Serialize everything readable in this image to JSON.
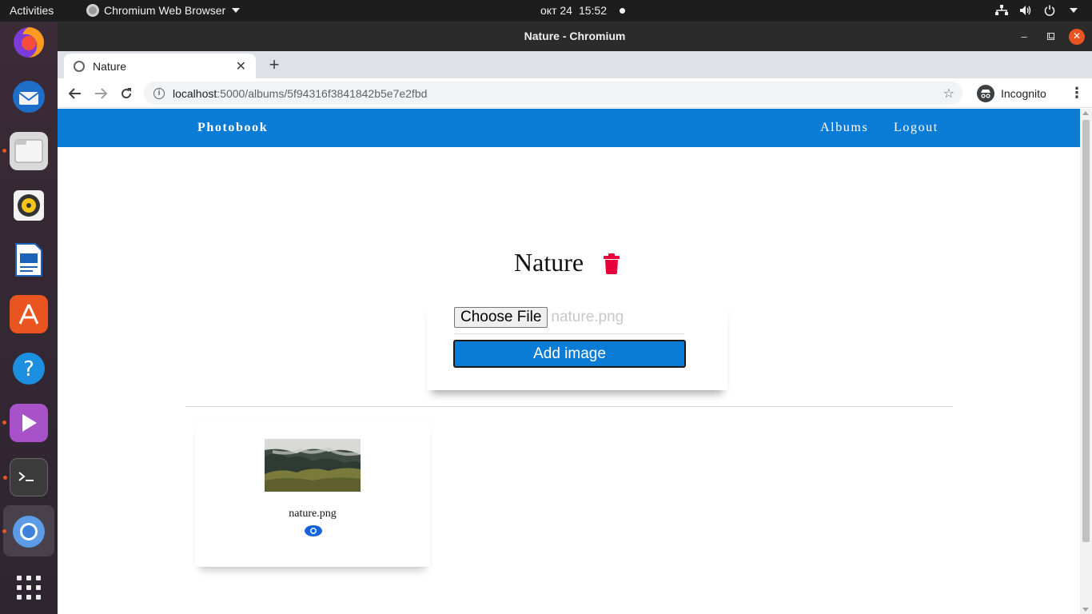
{
  "os": {
    "activities": "Activities",
    "app_name": "Chromium Web Browser",
    "clock_date": "окт 24",
    "clock_time": "15:52"
  },
  "window": {
    "title": "Nature - Chromium"
  },
  "browser": {
    "tab_title": "Nature",
    "url_host": "localhost",
    "url_path": ":5000/albums/5f94316f3841842b5e7e2fbd",
    "incognito_label": "Incognito"
  },
  "page": {
    "brand": "Photobook",
    "nav_links": [
      "Albums",
      "Logout"
    ],
    "album_title": "Nature",
    "choose_file_label": "Choose File",
    "file_input_value": "nature.png",
    "add_image_label": "Add image",
    "images": [
      {
        "name": "nature.png"
      }
    ],
    "colors": {
      "primary": "#0a7cd6",
      "danger": "#e8003d"
    }
  }
}
